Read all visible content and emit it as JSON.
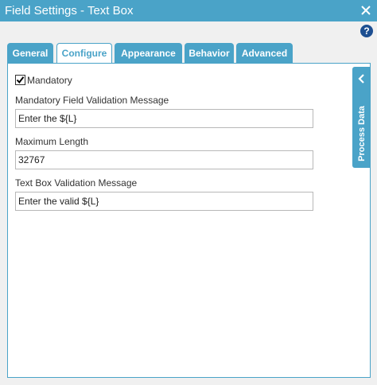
{
  "window": {
    "title": "Field Settings - Text Box",
    "close_icon": "close-icon",
    "help_label": "?"
  },
  "tabs": [
    {
      "label": "General",
      "active": false
    },
    {
      "label": "Configure",
      "active": true
    },
    {
      "label": "Appearance",
      "active": false
    },
    {
      "label": "Behavior",
      "active": false
    },
    {
      "label": "Advanced",
      "active": false
    }
  ],
  "configure": {
    "mandatory": {
      "label": "Mandatory",
      "checked": true
    },
    "mandatory_message": {
      "label": "Mandatory Field Validation Message",
      "value": "Enter the ${L}"
    },
    "max_length": {
      "label": "Maximum Length",
      "value": "32767"
    },
    "validation_message": {
      "label": "Text Box Validation Message",
      "value": "Enter the valid ${L}"
    }
  },
  "side_panel": {
    "label": "Process Data",
    "icon": "chevron-left-icon"
  },
  "colors": {
    "accent": "#4aa3c8",
    "help": "#1d4f91"
  }
}
